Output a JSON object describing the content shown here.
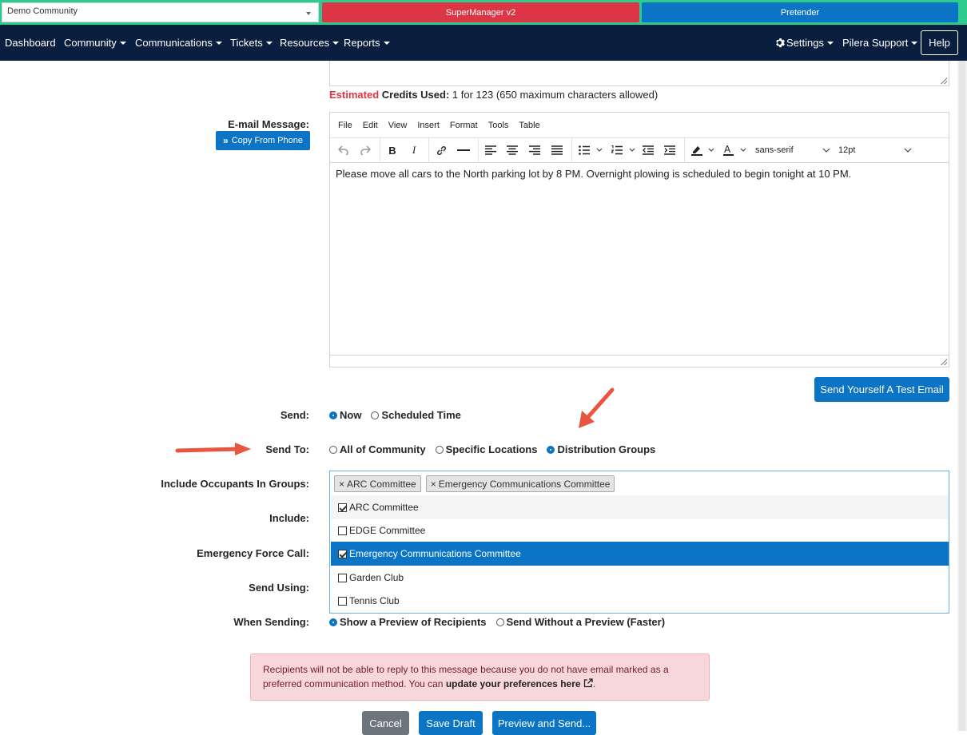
{
  "topbar": {
    "community_select": "Demo Community",
    "supermanager_label": "SuperManager v2",
    "pretender_label": "Pretender"
  },
  "nav": {
    "items": [
      "Dashboard",
      "Community",
      "Communications",
      "Tickets",
      "Resources",
      "Reports"
    ],
    "settings": "Settings",
    "support": "Pilera Support",
    "help": "Help"
  },
  "sms": {
    "estimated": "Estimated",
    "credits_label": "Credits Used:",
    "credits_value": "1 for 123 (650 maximum characters allowed)"
  },
  "email": {
    "label": "E-mail Message:",
    "copy_button": "Copy From Phone",
    "menu": [
      "File",
      "Edit",
      "View",
      "Insert",
      "Format",
      "Tools",
      "Table"
    ],
    "font_family": "sans-serif",
    "font_size": "12pt",
    "body": "Please move all cars to the North parking lot by 8 PM. Overnight plowing is scheduled to begin tonight at 10 PM.",
    "test_button": "Send Yourself A Test Email"
  },
  "form": {
    "send_label": "Send:",
    "send_options": [
      "Now",
      "Scheduled Time"
    ],
    "send_selected": "Now",
    "send_to_label": "Send To:",
    "send_to_options": [
      "All of Community",
      "Specific Locations",
      "Distribution Groups"
    ],
    "send_to_selected": "Distribution Groups",
    "include_groups_label": "Include Occupants In Groups:",
    "include_label": "Include:",
    "force_call_label": "Emergency Force Call:",
    "send_using_label": "Send Using:",
    "when_sending_label": "When Sending:",
    "when_sending_options": [
      "Show a Preview of Recipients",
      "Send Without a Preview (Faster)"
    ],
    "when_sending_selected": "Show a Preview of Recipients"
  },
  "groups": {
    "chips": [
      "ARC Committee",
      "Emergency Communications Committee"
    ],
    "options": [
      {
        "label": "ARC Committee",
        "checked": true
      },
      {
        "label": "EDGE Committee",
        "checked": false
      },
      {
        "label": "Emergency Communications Committee",
        "checked": true
      },
      {
        "label": "Garden Club",
        "checked": false
      },
      {
        "label": "Tennis Club",
        "checked": false
      }
    ]
  },
  "alert": {
    "text": "Recipients will not be able to reply to this message because you do not have email marked as a preferred communication method. You can",
    "link": "update your preferences here"
  },
  "actions": {
    "cancel": "Cancel",
    "save_draft": "Save Draft",
    "preview_send": "Preview and Send..."
  },
  "colors": {
    "navbar": "#0a1f3f",
    "primary": "#0b74c4",
    "danger": "#dc3545",
    "strip": "#2ecc8c",
    "arrow": "#e8563f"
  }
}
